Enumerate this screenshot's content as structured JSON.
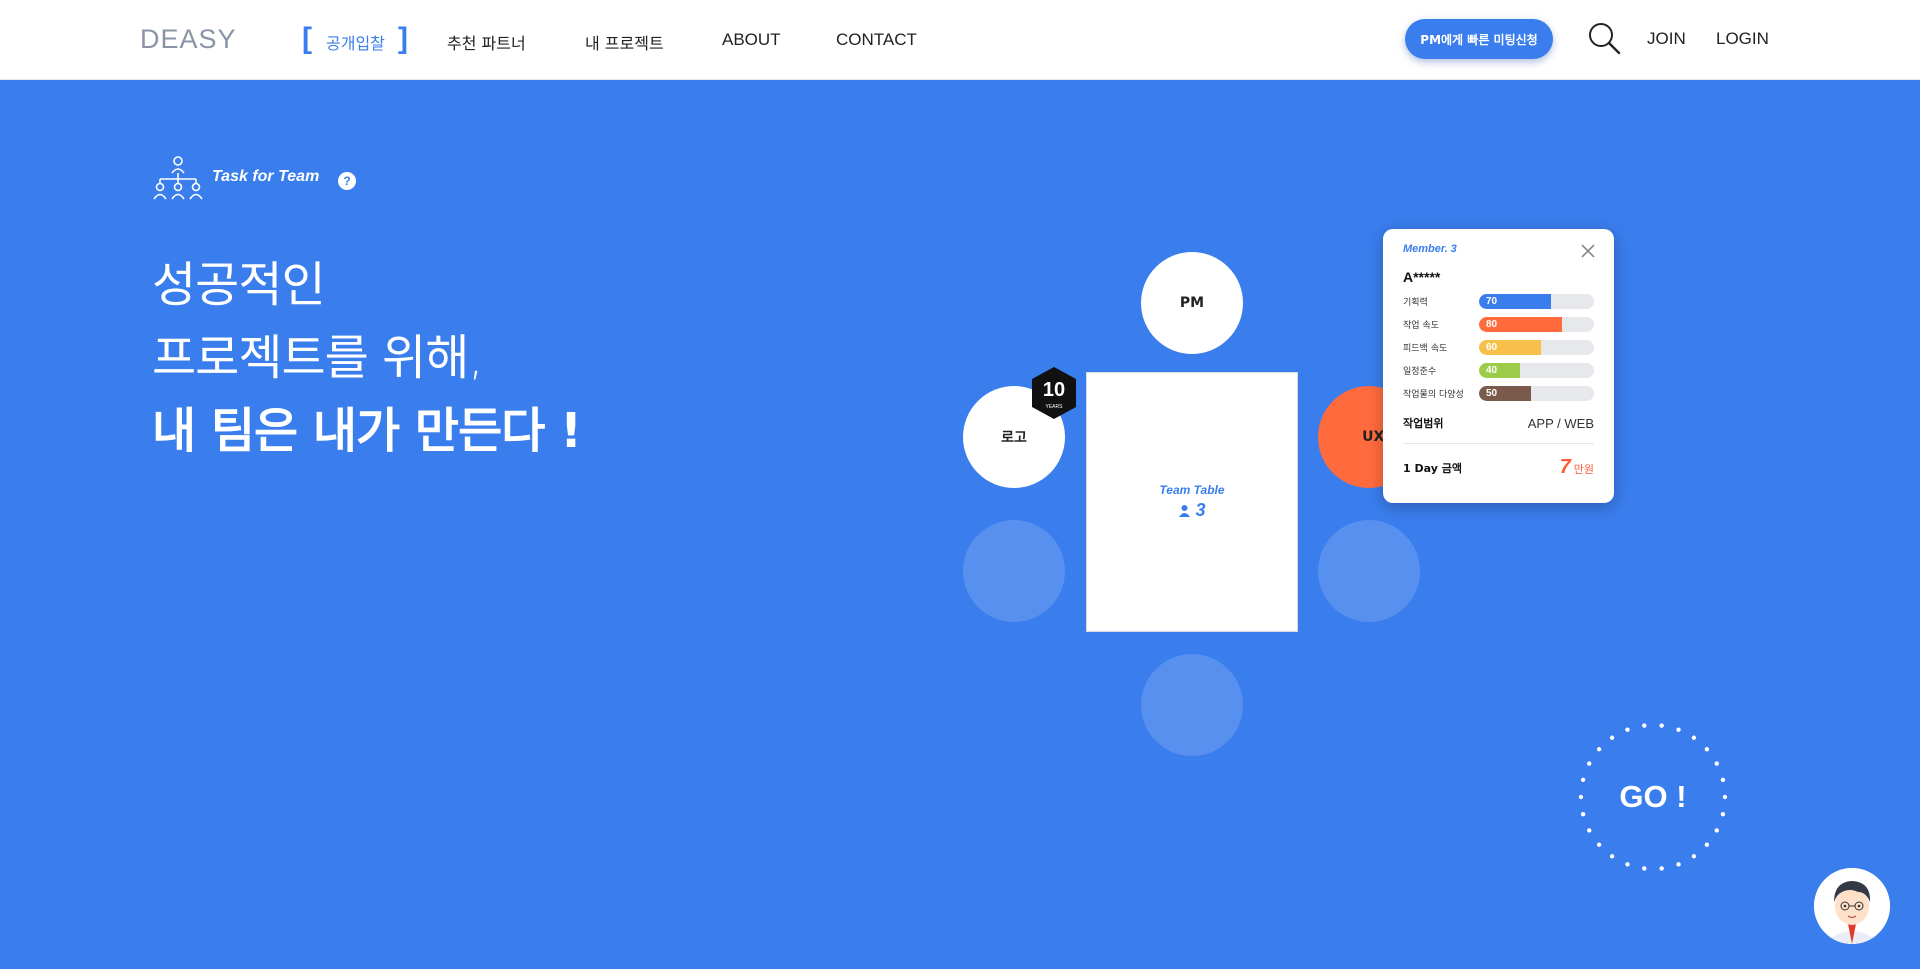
{
  "header": {
    "logo": "DEASY",
    "nav": [
      {
        "label": "공개입찰",
        "active": true
      },
      {
        "label": "추천 파트너"
      },
      {
        "label": "내 프로젝트"
      },
      {
        "label": "ABOUT"
      },
      {
        "label": "CONTACT"
      }
    ],
    "cta_label": "PM에게 빠른 미팅신청",
    "join_label": "JOIN",
    "login_label": "LOGIN"
  },
  "hero": {
    "task_title": "Task for Team",
    "help": "?",
    "lines": [
      "성공적인",
      "프로젝트를 위해,",
      "내 팀은 내가 만든다 !"
    ]
  },
  "team": {
    "pm_label": "PM",
    "logo_label": "로고",
    "ux_label": "UX · UI",
    "table_title": "Team Table",
    "table_count": "3",
    "years_number": "10",
    "years_text": "YEARS"
  },
  "member_card": {
    "label": "Member. 3",
    "name": "A*****",
    "stats": [
      {
        "label": "기획력",
        "value": 70,
        "color": "#3a7ded"
      },
      {
        "label": "작업 속도",
        "value": 80,
        "color": "#ff6b3d"
      },
      {
        "label": "피드백 속도",
        "value": 60,
        "color": "#f7c04a"
      },
      {
        "label": "일정준수",
        "value": 40,
        "color": "#9ccc4a"
      },
      {
        "label": "작업물의 다양성",
        "value": 50,
        "color": "#7a5a4a"
      }
    ],
    "scope_label": "작업범위",
    "scope_value": "APP / WEB",
    "price_label": "1 Day 금액",
    "price_number": "7",
    "price_unit": "만원"
  },
  "go_label": "GO !",
  "colors": {
    "primary": "#3a7ded",
    "accent": "#ff6b3d"
  }
}
